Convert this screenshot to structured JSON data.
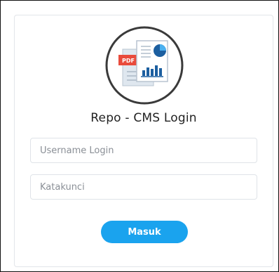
{
  "login": {
    "title": "Repo - CMS Login",
    "username_placeholder": "Username Login",
    "password_placeholder": "Katakunci",
    "submit_label": "Masuk"
  },
  "logo": {
    "pdf_badge": "PDF",
    "icon": "document-report-icon"
  },
  "colors": {
    "accent": "#1aa3ee",
    "pdf_red": "#e94b3c"
  }
}
